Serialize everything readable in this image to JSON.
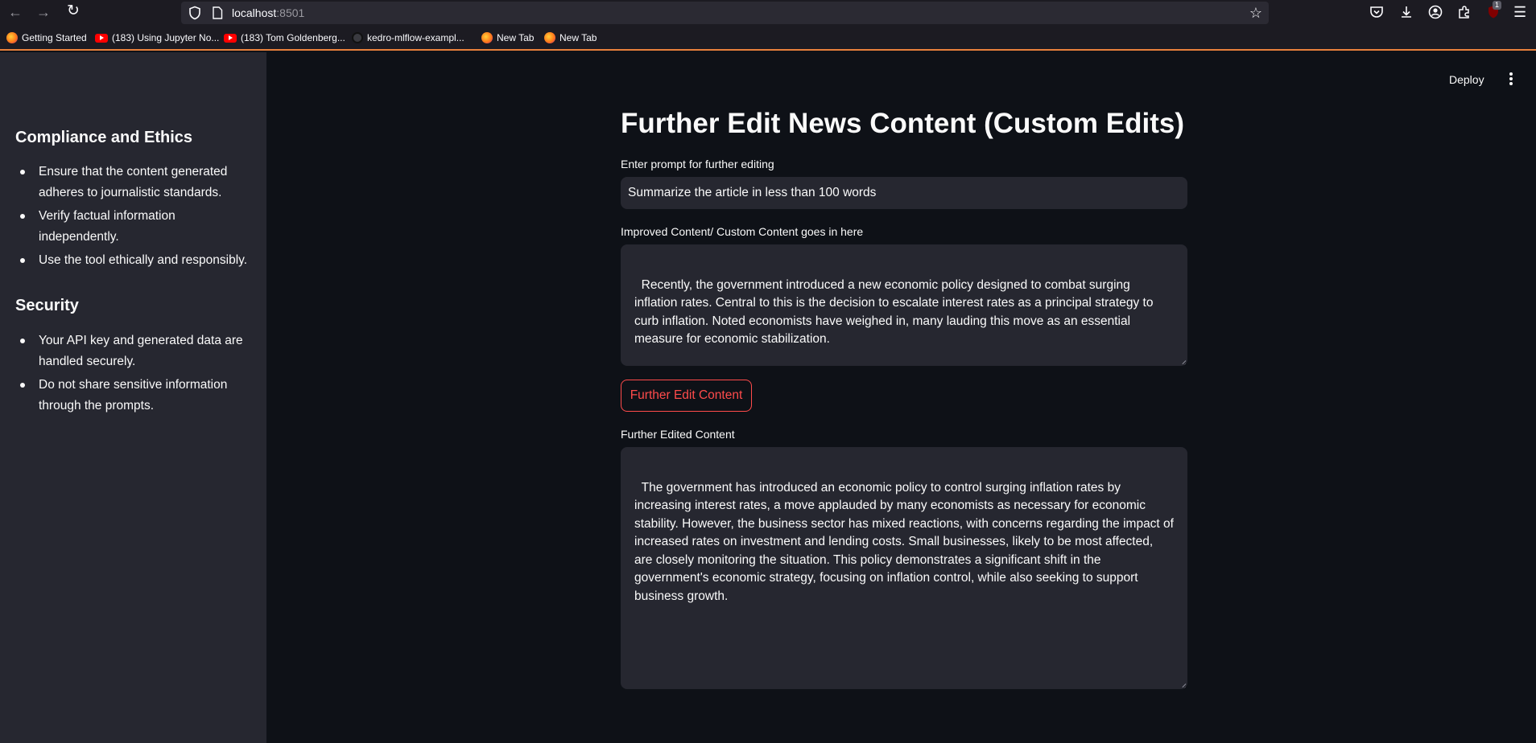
{
  "browser": {
    "url_host": "localhost",
    "url_port": ":8501",
    "notification_badge": "1",
    "bookmarks": [
      {
        "label": "Getting Started",
        "icon": "firefox-icon"
      },
      {
        "label": "(183) Using Jupyter No...",
        "icon": "youtube-icon"
      },
      {
        "label": "(183) Tom Goldenberg...",
        "icon": "youtube-icon"
      },
      {
        "label": "kedro-mlflow-exampl...",
        "icon": "github-icon"
      },
      {
        "label": "New Tab",
        "icon": "firefox-icon"
      },
      {
        "label": "New Tab",
        "icon": "firefox-icon"
      }
    ]
  },
  "header": {
    "deploy_label": "Deploy"
  },
  "sidebar": {
    "sections": [
      {
        "heading": "Compliance and Ethics",
        "items": [
          "Ensure that the content generated adheres to journalistic standards.",
          "Verify factual information independently.",
          "Use the tool ethically and responsibly."
        ]
      },
      {
        "heading": "Security",
        "items": [
          "Your API key and generated data are handled securely.",
          "Do not share sensitive information through the prompts."
        ]
      }
    ]
  },
  "main": {
    "title": "Further Edit News Content (Custom Edits)",
    "prompt_label": "Enter prompt for further editing",
    "prompt_value": "Summarize the article in less than 100 words",
    "improved_label": "Improved Content/ Custom Content goes in here",
    "improved_text": "Recently, the government introduced a new economic policy designed to combat surging inflation rates. Central to this is the decision to escalate interest rates as a principal strategy to curb inflation. Noted economists have weighed in, many lauding this move as an essential measure for economic stabilization.\n\nReactions from the business sector were mixed; some voiced worries about the potential impact",
    "button_label": "Further Edit Content",
    "edited_label": "Further Edited Content",
    "edited_text": "The government has introduced an economic policy to control surging inflation rates by increasing interest rates, a move applauded by many economists as necessary for economic stability. However, the business sector has mixed reactions, with concerns regarding the impact of increased rates on investment and lending costs. Small businesses, likely to be most affected, are closely monitoring the situation. This policy demonstrates a significant shift in the government's economic strategy, focusing on inflation control, while also seeking to support business growth."
  },
  "colors": {
    "accent": "#ff4b4b",
    "sidebar_bg": "#262730",
    "main_bg": "#0e1117",
    "input_bg": "#262730"
  }
}
